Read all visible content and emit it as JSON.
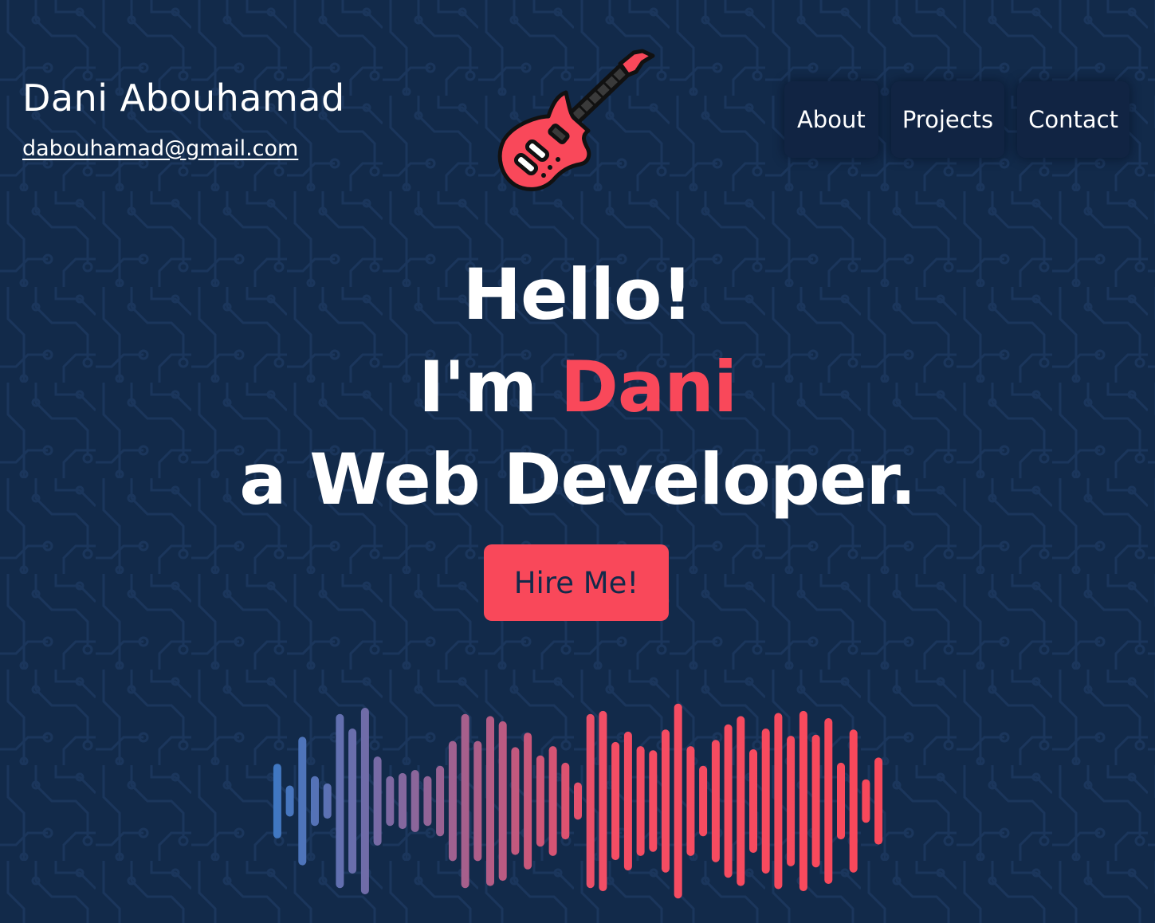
{
  "header": {
    "name": "Dani Abouhamad",
    "email": "dabouhamad@gmail.com",
    "logo_icon": "electric-guitar-icon"
  },
  "nav": {
    "items": [
      {
        "label": "About"
      },
      {
        "label": "Projects"
      },
      {
        "label": "Contact"
      }
    ]
  },
  "hero": {
    "line1": "Hello!",
    "line2_prefix": "I'm ",
    "line2_highlight": "Dani",
    "line3": "a Web Developer.",
    "cta_label": "Hire Me!"
  },
  "colors": {
    "background": "#122a4a",
    "circuit": "#1b365c",
    "accent": "#f9485a",
    "nav_bg": "#112443",
    "wave_start": "#3d78c3",
    "wave_end": "#f9485a"
  },
  "soundwave": {
    "icon": "audio-waveform-icon",
    "levels": [
      0.36,
      0.15,
      0.62,
      0.24,
      0.17,
      0.84,
      0.7,
      0.9,
      0.43,
      0.24,
      0.27,
      0.3,
      0.24,
      0.34,
      0.58,
      0.84,
      0.58,
      0.82,
      0.77,
      0.52,
      0.66,
      0.44,
      0.53,
      0.37,
      0.18,
      0.84,
      0.87,
      0.57,
      0.67,
      0.53,
      0.49,
      0.69,
      0.94,
      0.53,
      0.34,
      0.59,
      0.74,
      0.82,
      0.5,
      0.7,
      0.85,
      0.63,
      0.87,
      0.64,
      0.8,
      0.37,
      0.69,
      0.21,
      0.42
    ]
  }
}
